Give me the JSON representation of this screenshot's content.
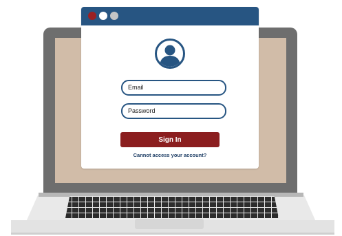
{
  "window": {
    "traffic_lights": [
      "#9b2023",
      "#ffffff",
      "#c5c5c5"
    ],
    "titlebar_color": "#275582"
  },
  "login": {
    "avatar_icon": "user-icon",
    "email_placeholder": "Email",
    "password_placeholder": "Password",
    "signin_label": "Sign In",
    "forgot_link": "Cannot access your account?",
    "button_color": "#8b1e1f"
  },
  "laptop": {
    "screen_color": "#d1bca8",
    "frame_color": "#6e6e6e"
  }
}
